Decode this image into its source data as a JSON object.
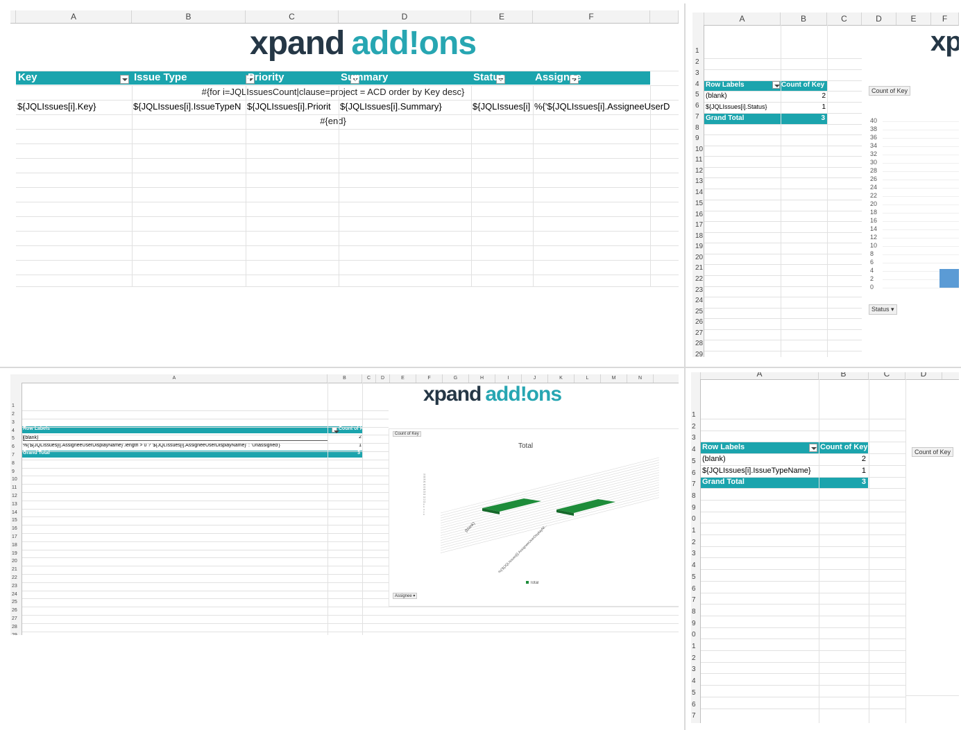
{
  "logo": {
    "part1": "xpand",
    "part2": "add!ons"
  },
  "panel1": {
    "columns": [
      "A",
      "B",
      "C",
      "D",
      "E",
      "F"
    ],
    "headers": [
      "Key",
      "Issue Type",
      "Priority",
      "Summary",
      "Status",
      "Assignee"
    ],
    "for_line": "#{for i=JQLIssuesCount|clause=project = ACD order by Key desc}",
    "row": [
      "${JQLIssues[i].Key}",
      "${JQLIssues[i].IssueTypeN",
      "${JQLIssues[i].Priorit",
      "${JQLIssues[i].Summary}",
      "${JQLIssues[i]",
      "%{'${JQLIssues[i].AssigneeUserD"
    ],
    "end_line": "#{end}"
  },
  "panel2": {
    "columns": [
      "A",
      "B",
      "C",
      "D",
      "E",
      "F"
    ],
    "rows": [
      "1",
      "2",
      "3",
      "4",
      "5",
      "6",
      "7",
      "8",
      "9",
      "10",
      "11",
      "12",
      "13",
      "14",
      "15",
      "16",
      "17",
      "18",
      "19",
      "20",
      "21",
      "22",
      "23",
      "24",
      "25",
      "26",
      "27",
      "28",
      "29"
    ],
    "pivot": {
      "header_labels": "Row Labels",
      "header_count": "Count of Key",
      "r1_label": "(blank)",
      "r1_val": "2",
      "r2_label": "${JQLIssues[i].Status}",
      "r2_val": "1",
      "total_label": "Grand Total",
      "total_val": "3"
    },
    "chart_chip": "Count of Key",
    "filter_chip": "Status",
    "yticks": [
      "40",
      "38",
      "36",
      "34",
      "32",
      "30",
      "28",
      "26",
      "24",
      "22",
      "20",
      "18",
      "16",
      "14",
      "12",
      "10",
      "8",
      "6",
      "4",
      "2",
      "0"
    ]
  },
  "panel3": {
    "columns": [
      "A",
      "B",
      "C",
      "D",
      "E",
      "F",
      "G",
      "H",
      "I",
      "J",
      "K",
      "L",
      "M",
      "N"
    ],
    "rows": [
      "1",
      "2",
      "3",
      "4",
      "5",
      "6",
      "7",
      "8",
      "9",
      "10",
      "11",
      "12",
      "13",
      "14",
      "15",
      "16",
      "17",
      "18",
      "19",
      "20",
      "21",
      "22",
      "23",
      "24",
      "25",
      "26",
      "27",
      "28",
      "29"
    ],
    "pivot": {
      "header_labels": "Row Labels",
      "header_count": "Count of Key",
      "r1_label": "(blank)",
      "r1_val": "2",
      "r2_label": "%{'${JQLIssues[i].AssigneeUserDisplayName}'.length > 0 ? '${JQLIssues[i].AssigneeUserDisplayName}' : 'Unassigned'}",
      "r2_val": "1",
      "total_label": "Grand Total",
      "total_val": "3"
    },
    "chart_chip": "Count of Key",
    "chart_title": "Total",
    "legend": "Total",
    "filter_chip": "Assignee",
    "cat1": "(blank)",
    "cat2": "%{'${JQLIssues[i].AssigneeUserDisplayNl..."
  },
  "panel4": {
    "columns": [
      "A",
      "B",
      "C",
      "D"
    ],
    "rows": [
      "1",
      "2",
      "3",
      "4",
      "5",
      "6",
      "7",
      "8",
      "9",
      "0",
      "1",
      "2",
      "3",
      "4",
      "5",
      "6",
      "7",
      "8",
      "9",
      "0",
      "1",
      "2",
      "3",
      "4",
      "5",
      "6",
      "7"
    ],
    "pivot": {
      "header_labels": "Row Labels",
      "header_count": "Count of Key",
      "r1_label": "(blank)",
      "r1_val": "2",
      "r2_label": "${JQLIssues[i].IssueTypeName}",
      "r2_val": "1",
      "total_label": "Grand Total",
      "total_val": "3"
    },
    "chart_chip": "Count of Key"
  },
  "chart_data": [
    {
      "type": "bar",
      "categories": [
        "(blank)",
        "${JQLIssues[i].Status}"
      ],
      "values": [
        2,
        1
      ],
      "ylim": [
        0,
        40
      ]
    },
    {
      "type": "bar",
      "title": "Total",
      "categories": [
        "(blank)",
        "%{'${JQLIssues[i].AssigneeUserDisplayNl..."
      ],
      "series": [
        {
          "name": "Total",
          "values": [
            2,
            1
          ]
        }
      ]
    }
  ],
  "colors": {
    "teal": "#1ba4ad",
    "green": "#1e8c3a",
    "blue": "#5b9bd5"
  }
}
